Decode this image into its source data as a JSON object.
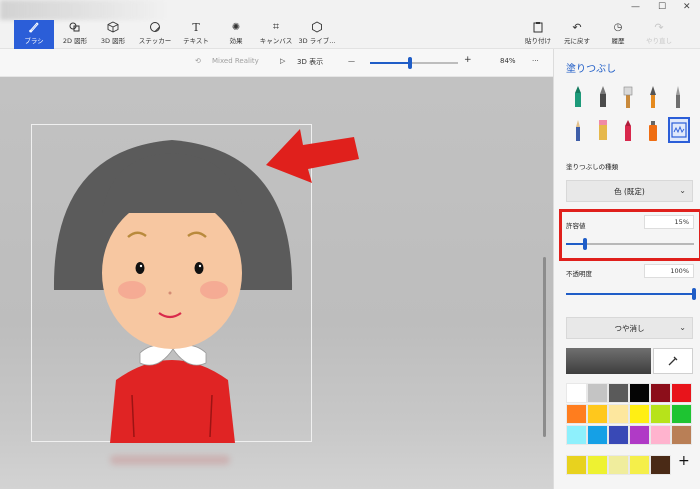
{
  "toolbar": {
    "tools": [
      {
        "id": "brush",
        "label": "ブラシ",
        "icon": "brush-icon",
        "active": true
      },
      {
        "id": "2dshape",
        "label": "2D 図形",
        "icon": "2d-shapes-icon"
      },
      {
        "id": "3dshape",
        "label": "3D 図形",
        "icon": "3d-shapes-icon"
      },
      {
        "id": "sticker",
        "label": "ステッカー",
        "icon": "sticker-icon"
      },
      {
        "id": "text",
        "label": "テキスト",
        "icon": "text-icon"
      },
      {
        "id": "effects",
        "label": "効果",
        "icon": "effects-icon"
      },
      {
        "id": "canvas",
        "label": "キャンバス",
        "icon": "canvas-icon"
      },
      {
        "id": "3dlib",
        "label": "3D ライブ...",
        "icon": "3d-library-icon"
      }
    ],
    "right_tools": [
      {
        "id": "paste",
        "label": "貼り付け",
        "icon": "paste-icon"
      },
      {
        "id": "undo",
        "label": "元に戻す",
        "icon": "undo-icon"
      },
      {
        "id": "history",
        "label": "履歴",
        "icon": "history-icon"
      },
      {
        "id": "redo",
        "label": "やり直し",
        "icon": "redo-icon",
        "disabled": true
      }
    ],
    "window_controls": {
      "minimize": "—",
      "maximize": "☐",
      "close": "✕"
    }
  },
  "subbar": {
    "mixed_reality": "Mixed Reality",
    "view_3d": "3D 表示",
    "zoom_minus": "—",
    "zoom_plus": "+",
    "zoom_value": "84%",
    "more": "···",
    "zoom_level": 0.45
  },
  "panel": {
    "title": "塗りつぶし",
    "fill_type_label": "塗りつぶしの種類",
    "fill_type_value": "色 (既定)",
    "tolerance_label": "許容値",
    "tolerance_value": "15%",
    "tolerance_level": 0.15,
    "opacity_label": "不透明度",
    "opacity_value": "100%",
    "opacity_level": 1.0,
    "finish_value": "つや消し",
    "add_color": "+",
    "colors": [
      "#ffffff",
      "#c4c4c4",
      "#5a5a5a",
      "#050505",
      "#8c0e1a",
      "#e8141b",
      "#ff7d1e",
      "#ffc81c",
      "#fde79e",
      "#ffef14",
      "#b7e31a",
      "#1ec432",
      "#8ef0fc",
      "#15a0e6",
      "#3949b6",
      "#b03ac6",
      "#ffb3ce",
      "#b97f56"
    ],
    "custom_colors": [
      "#e8d21e",
      "#eef231",
      "#f0ed9d",
      "#f5ef4a",
      "#4a2a16"
    ]
  },
  "accent": "#1f5dc7",
  "annotation_color": "#e0201c"
}
